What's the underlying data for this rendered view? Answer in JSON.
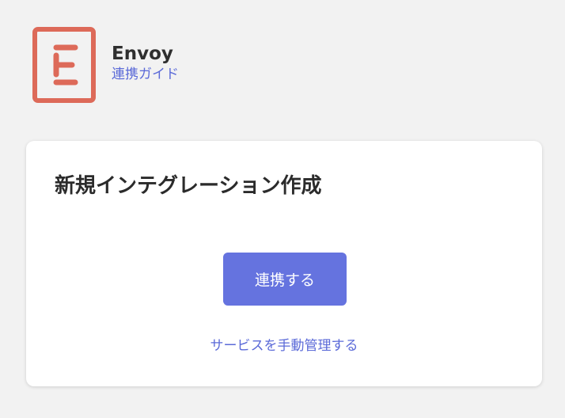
{
  "app": {
    "logo_icon": "envoy-logo-icon",
    "brand_color": "#dd6a59",
    "name": "Envoy",
    "guide_link": "連携ガイド"
  },
  "card": {
    "title": "新規インテグレーション作成",
    "connect_button": "連携する",
    "manual_link": "サービスを手動管理する"
  },
  "colors": {
    "accent": "#6573df",
    "link": "#5b6ad8",
    "background": "#f2f2f2"
  }
}
